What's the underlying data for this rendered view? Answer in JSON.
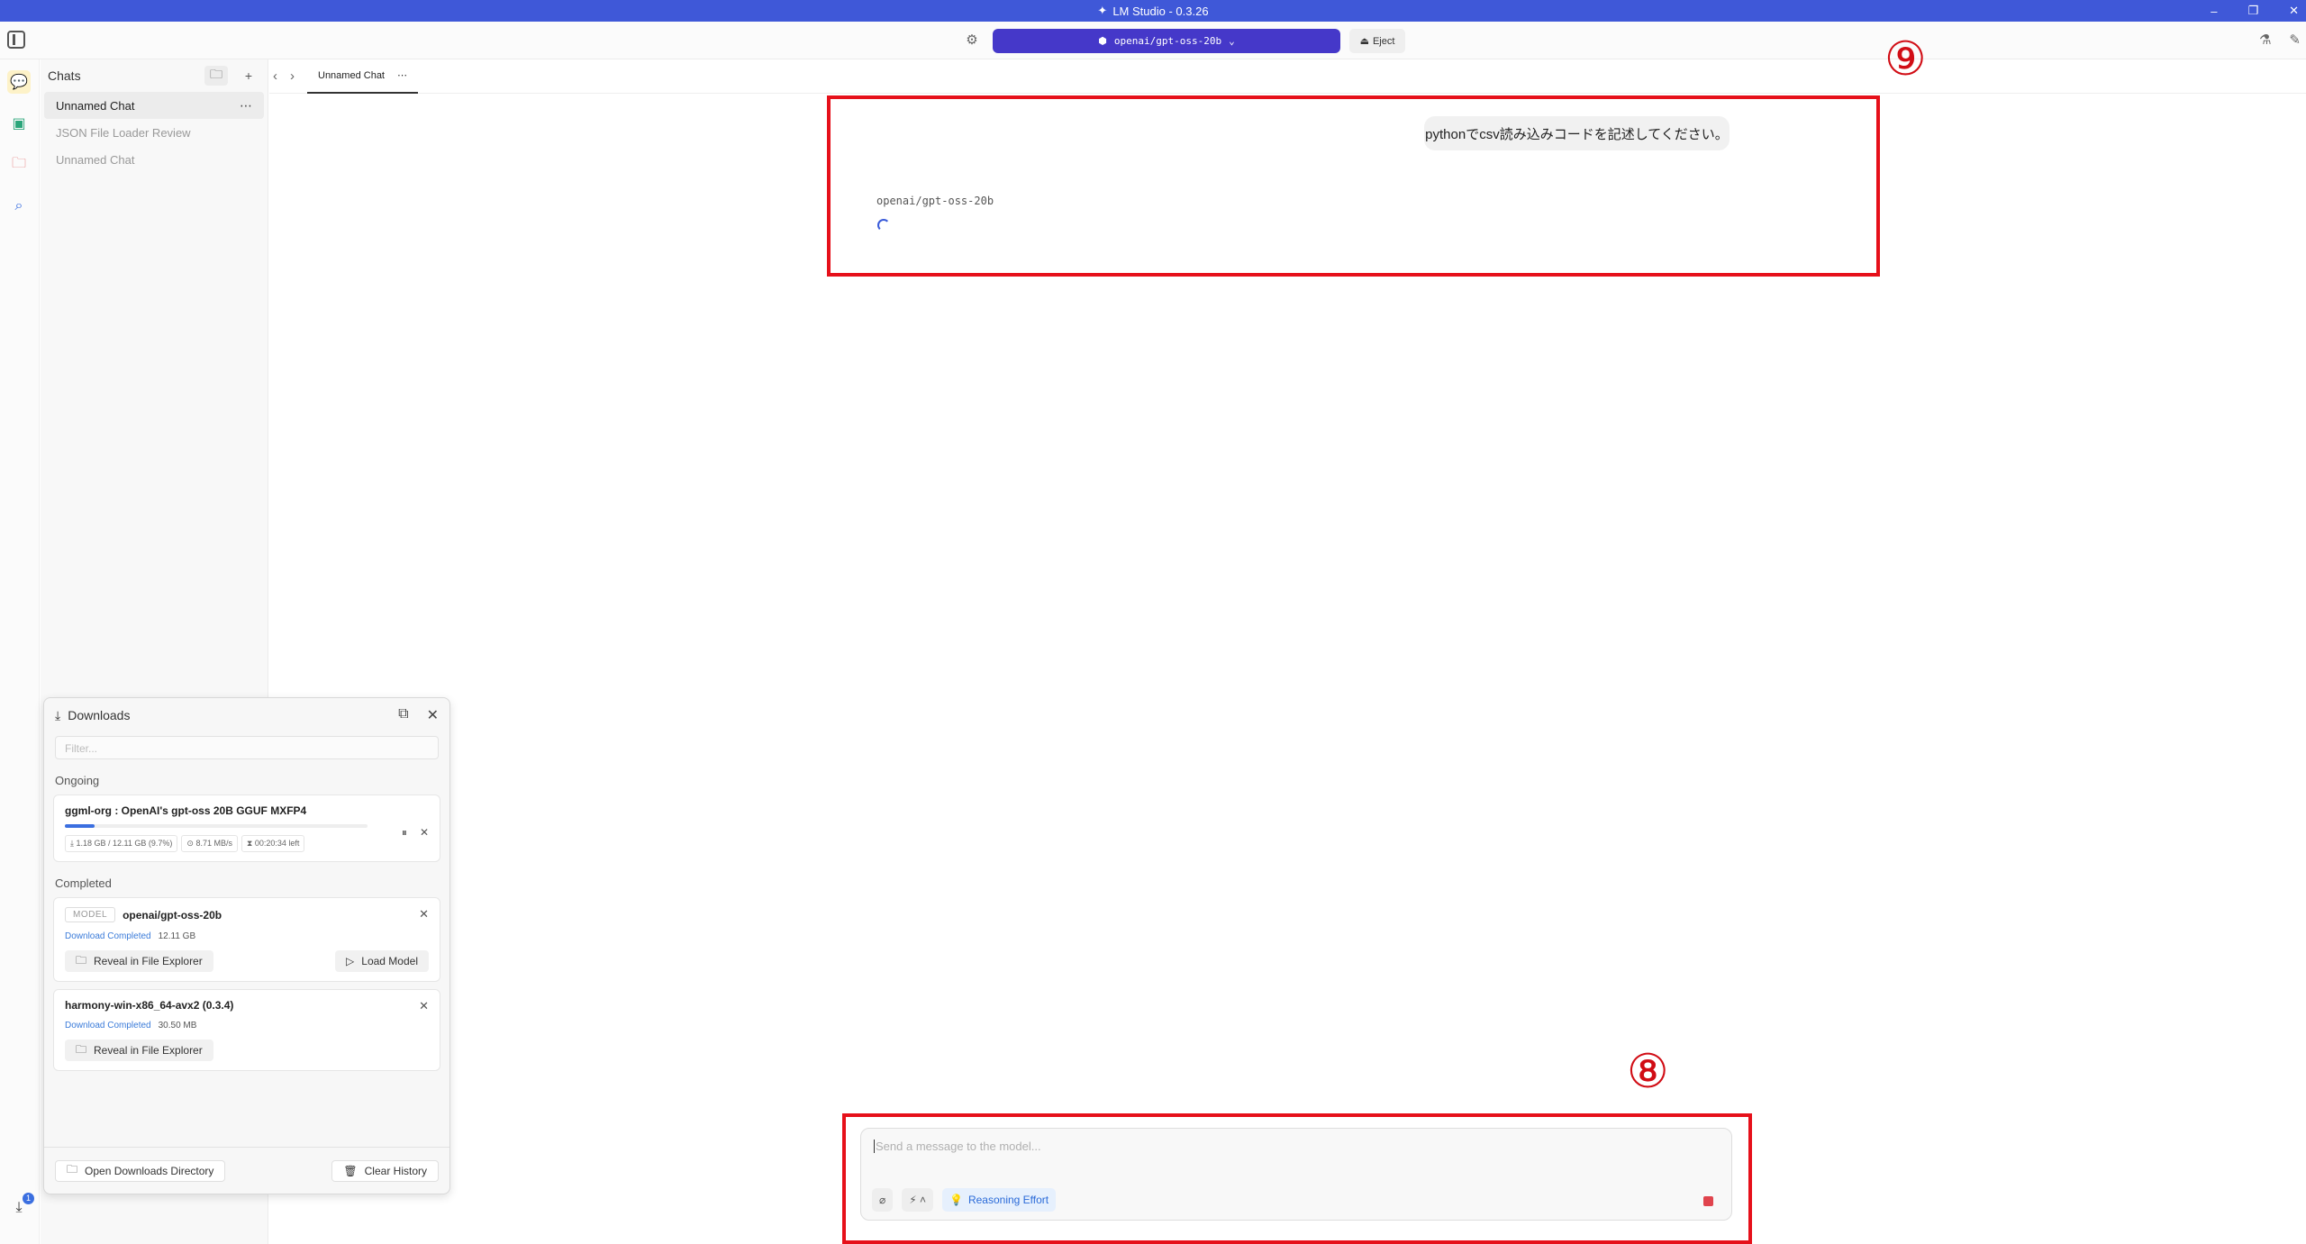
{
  "window": {
    "title": "LM Studio - 0.3.26",
    "controls": [
      "–",
      "❐",
      "✕"
    ]
  },
  "topbar": {
    "model_label": "openai/gpt-oss-20b",
    "eject_label": "Eject"
  },
  "chats": {
    "header": "Chats",
    "items": [
      {
        "label": "Unnamed Chat",
        "active": true
      },
      {
        "label": "JSON File Loader Review",
        "active": false
      },
      {
        "label": "Unnamed Chat",
        "active": false
      }
    ]
  },
  "tab": {
    "label": "Unnamed Chat"
  },
  "conversation": {
    "user_message": "pythonでcsv読み込みコードを記述してください。",
    "assistant_model": "openai/gpt-oss-20b"
  },
  "annotations": {
    "top": "⑨",
    "bottom": "⑧"
  },
  "composer": {
    "placeholder": "Send a message to the model...",
    "reasoning_label": "Reasoning Effort"
  },
  "downloads": {
    "title": "Downloads",
    "filter_placeholder": "Filter...",
    "ongoing_label": "Ongoing",
    "completed_label": "Completed",
    "ongoing": {
      "name": "ggml-org : OpenAI's gpt-oss 20B GGUF MXFP4",
      "progress": 0.097,
      "size": "1.18 GB / 12.11 GB",
      "percent": "(9.7%)",
      "speed": "8.71 MB/s",
      "eta": "00:20:34 left"
    },
    "completed": [
      {
        "tag": "MODEL",
        "name": "openai/gpt-oss-20b",
        "status": "Download Completed",
        "size": "12.11 GB",
        "reveal": "Reveal in File Explorer",
        "load": "Load Model"
      },
      {
        "name": "harmony-win-x86_64-avx2 (0.3.4)",
        "status": "Download Completed",
        "size": "30.50 MB",
        "reveal": "Reveal in File Explorer"
      }
    ],
    "open_dir": "Open Downloads Directory",
    "clear": "Clear History",
    "badge_count": "1"
  }
}
